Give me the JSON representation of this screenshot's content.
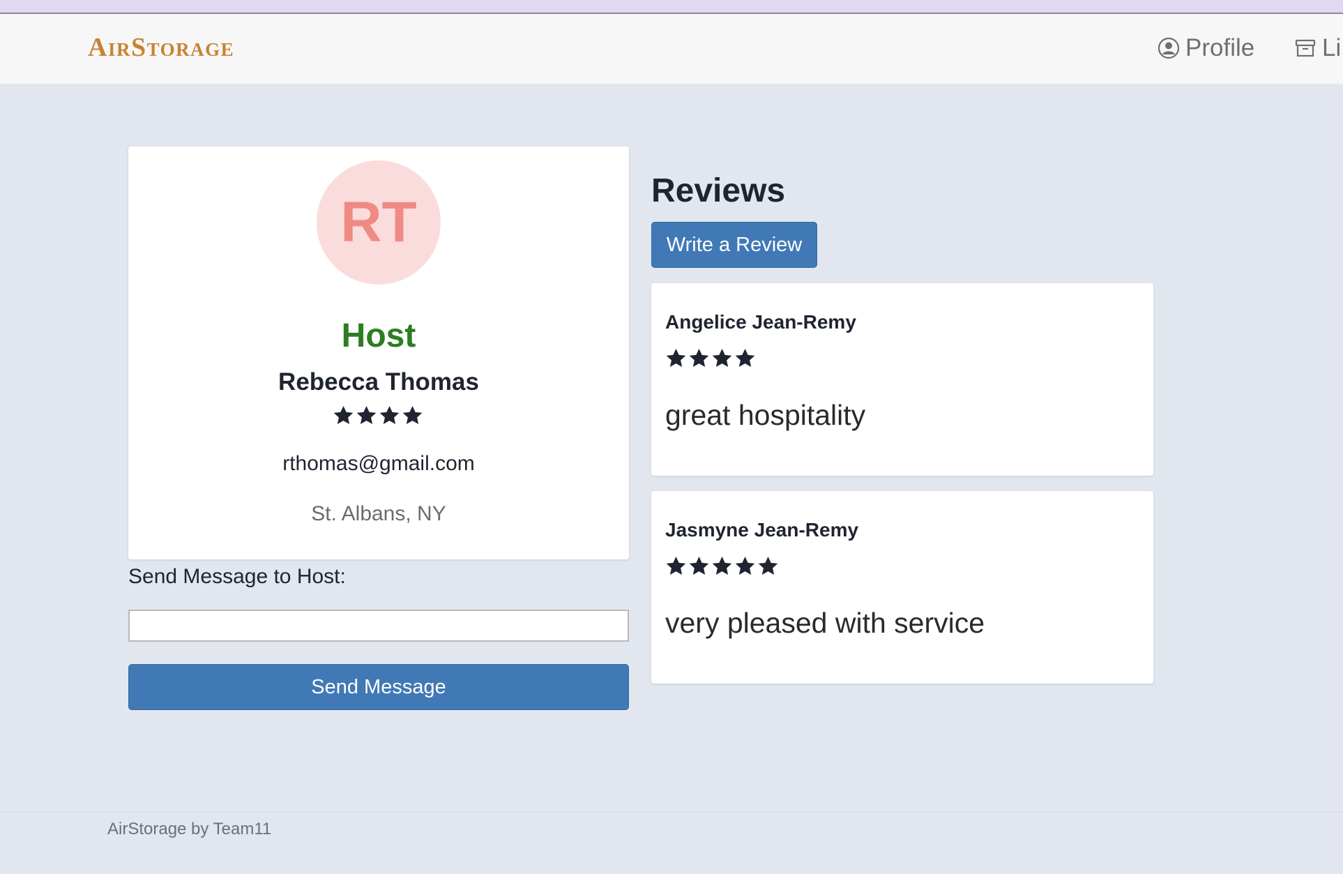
{
  "brand": {
    "name": "AirStorage"
  },
  "nav": {
    "profile_label": "Profile",
    "profile_icon": "user-circle-icon",
    "listings_label": "Li",
    "listings_icon": "archive-box-icon"
  },
  "host": {
    "initials": "RT",
    "role": "Host",
    "name": "Rebecca Thomas",
    "rating": 4,
    "email": "rthomas@gmail.com",
    "location": "St. Albans, NY"
  },
  "message": {
    "label": "Send Message to Host:",
    "value": "",
    "placeholder": "",
    "send_label": "Send Message"
  },
  "reviews": {
    "title": "Reviews",
    "write_label": "Write a Review",
    "items": [
      {
        "author": "Angelice Jean-Remy",
        "rating": 4,
        "text": "great hospitality"
      },
      {
        "author": "Jasmyne Jean-Remy",
        "rating": 5,
        "text": "very pleased with service"
      }
    ]
  },
  "footer": {
    "text": "AirStorage by Team11"
  },
  "colors": {
    "brand": "#c98232",
    "host_role": "#2e7d23",
    "button": "#4079b5",
    "avatar_bg": "#fbdcdc",
    "avatar_text": "#f08a84",
    "star": "#1f2430"
  }
}
